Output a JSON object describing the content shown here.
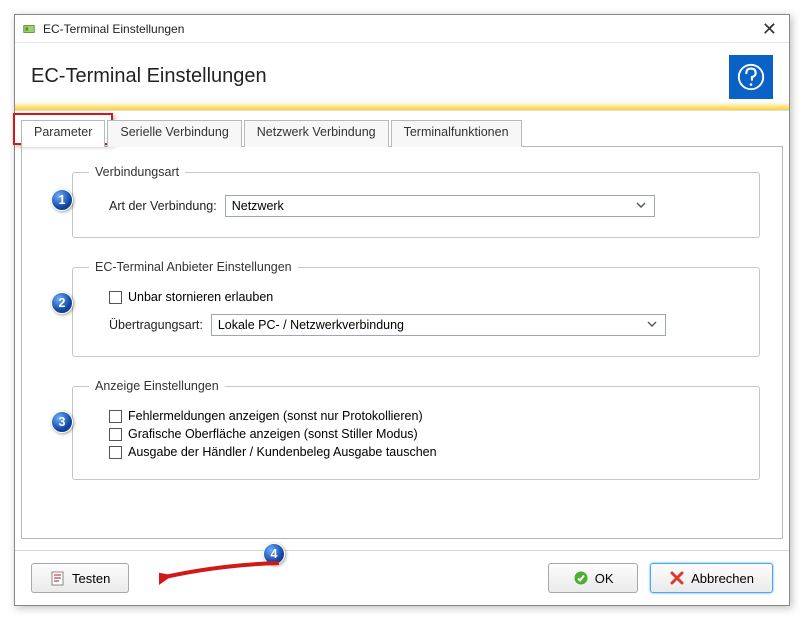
{
  "window": {
    "title": "EC-Terminal Einstellungen",
    "heading": "EC-Terminal Einstellungen"
  },
  "tabs": {
    "items": [
      {
        "label": "Parameter"
      },
      {
        "label": "Serielle Verbindung"
      },
      {
        "label": "Netzwerk Verbindung"
      },
      {
        "label": "Terminalfunktionen"
      }
    ]
  },
  "group_connection": {
    "legend": "Verbindungsart",
    "type_label": "Art der Verbindung:",
    "type_value": "Netzwerk"
  },
  "group_provider": {
    "legend": "EC-Terminal Anbieter Einstellungen",
    "checkbox_cancel": "Unbar stornieren erlauben",
    "transfer_label": "Übertragungsart:",
    "transfer_value": "Lokale PC- / Netzwerkverbindung"
  },
  "group_display": {
    "legend": "Anzeige Einstellungen",
    "check_errors": "Fehlermeldungen anzeigen (sonst nur Protokollieren)",
    "check_gui": "Grafische Oberfläche anzeigen (sonst Stiller Modus)",
    "check_swap": "Ausgabe der Händler / Kundenbeleg Ausgabe tauschen"
  },
  "footer": {
    "test": "Testen",
    "ok": "OK",
    "cancel": "Abbrechen"
  },
  "callouts": {
    "c1": "1",
    "c2": "2",
    "c3": "3",
    "c4": "4"
  }
}
